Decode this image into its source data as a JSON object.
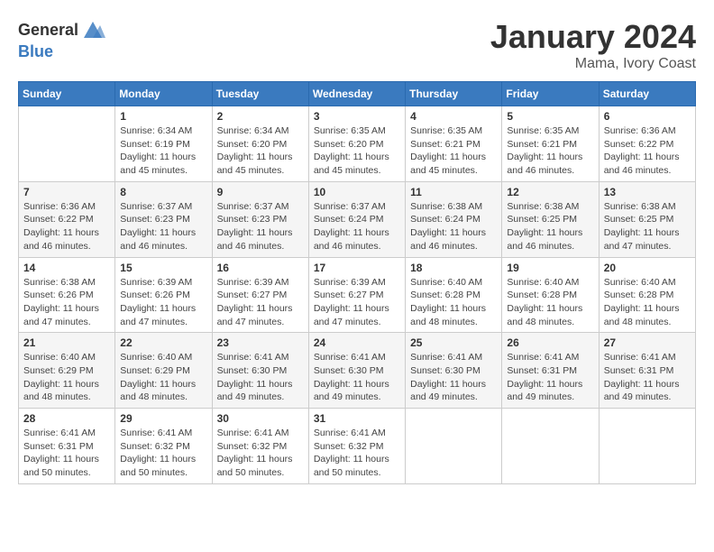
{
  "header": {
    "logo_general": "General",
    "logo_blue": "Blue",
    "month": "January 2024",
    "location": "Mama, Ivory Coast"
  },
  "weekdays": [
    "Sunday",
    "Monday",
    "Tuesday",
    "Wednesday",
    "Thursday",
    "Friday",
    "Saturday"
  ],
  "weeks": [
    [
      {
        "day": "",
        "sunrise": "",
        "sunset": "",
        "daylight": ""
      },
      {
        "day": "1",
        "sunrise": "Sunrise: 6:34 AM",
        "sunset": "Sunset: 6:19 PM",
        "daylight": "Daylight: 11 hours and 45 minutes."
      },
      {
        "day": "2",
        "sunrise": "Sunrise: 6:34 AM",
        "sunset": "Sunset: 6:20 PM",
        "daylight": "Daylight: 11 hours and 45 minutes."
      },
      {
        "day": "3",
        "sunrise": "Sunrise: 6:35 AM",
        "sunset": "Sunset: 6:20 PM",
        "daylight": "Daylight: 11 hours and 45 minutes."
      },
      {
        "day": "4",
        "sunrise": "Sunrise: 6:35 AM",
        "sunset": "Sunset: 6:21 PM",
        "daylight": "Daylight: 11 hours and 45 minutes."
      },
      {
        "day": "5",
        "sunrise": "Sunrise: 6:35 AM",
        "sunset": "Sunset: 6:21 PM",
        "daylight": "Daylight: 11 hours and 46 minutes."
      },
      {
        "day": "6",
        "sunrise": "Sunrise: 6:36 AM",
        "sunset": "Sunset: 6:22 PM",
        "daylight": "Daylight: 11 hours and 46 minutes."
      }
    ],
    [
      {
        "day": "7",
        "sunrise": "Sunrise: 6:36 AM",
        "sunset": "Sunset: 6:22 PM",
        "daylight": "Daylight: 11 hours and 46 minutes."
      },
      {
        "day": "8",
        "sunrise": "Sunrise: 6:37 AM",
        "sunset": "Sunset: 6:23 PM",
        "daylight": "Daylight: 11 hours and 46 minutes."
      },
      {
        "day": "9",
        "sunrise": "Sunrise: 6:37 AM",
        "sunset": "Sunset: 6:23 PM",
        "daylight": "Daylight: 11 hours and 46 minutes."
      },
      {
        "day": "10",
        "sunrise": "Sunrise: 6:37 AM",
        "sunset": "Sunset: 6:24 PM",
        "daylight": "Daylight: 11 hours and 46 minutes."
      },
      {
        "day": "11",
        "sunrise": "Sunrise: 6:38 AM",
        "sunset": "Sunset: 6:24 PM",
        "daylight": "Daylight: 11 hours and 46 minutes."
      },
      {
        "day": "12",
        "sunrise": "Sunrise: 6:38 AM",
        "sunset": "Sunset: 6:25 PM",
        "daylight": "Daylight: 11 hours and 46 minutes."
      },
      {
        "day": "13",
        "sunrise": "Sunrise: 6:38 AM",
        "sunset": "Sunset: 6:25 PM",
        "daylight": "Daylight: 11 hours and 47 minutes."
      }
    ],
    [
      {
        "day": "14",
        "sunrise": "Sunrise: 6:38 AM",
        "sunset": "Sunset: 6:26 PM",
        "daylight": "Daylight: 11 hours and 47 minutes."
      },
      {
        "day": "15",
        "sunrise": "Sunrise: 6:39 AM",
        "sunset": "Sunset: 6:26 PM",
        "daylight": "Daylight: 11 hours and 47 minutes."
      },
      {
        "day": "16",
        "sunrise": "Sunrise: 6:39 AM",
        "sunset": "Sunset: 6:27 PM",
        "daylight": "Daylight: 11 hours and 47 minutes."
      },
      {
        "day": "17",
        "sunrise": "Sunrise: 6:39 AM",
        "sunset": "Sunset: 6:27 PM",
        "daylight": "Daylight: 11 hours and 47 minutes."
      },
      {
        "day": "18",
        "sunrise": "Sunrise: 6:40 AM",
        "sunset": "Sunset: 6:28 PM",
        "daylight": "Daylight: 11 hours and 48 minutes."
      },
      {
        "day": "19",
        "sunrise": "Sunrise: 6:40 AM",
        "sunset": "Sunset: 6:28 PM",
        "daylight": "Daylight: 11 hours and 48 minutes."
      },
      {
        "day": "20",
        "sunrise": "Sunrise: 6:40 AM",
        "sunset": "Sunset: 6:28 PM",
        "daylight": "Daylight: 11 hours and 48 minutes."
      }
    ],
    [
      {
        "day": "21",
        "sunrise": "Sunrise: 6:40 AM",
        "sunset": "Sunset: 6:29 PM",
        "daylight": "Daylight: 11 hours and 48 minutes."
      },
      {
        "day": "22",
        "sunrise": "Sunrise: 6:40 AM",
        "sunset": "Sunset: 6:29 PM",
        "daylight": "Daylight: 11 hours and 48 minutes."
      },
      {
        "day": "23",
        "sunrise": "Sunrise: 6:41 AM",
        "sunset": "Sunset: 6:30 PM",
        "daylight": "Daylight: 11 hours and 49 minutes."
      },
      {
        "day": "24",
        "sunrise": "Sunrise: 6:41 AM",
        "sunset": "Sunset: 6:30 PM",
        "daylight": "Daylight: 11 hours and 49 minutes."
      },
      {
        "day": "25",
        "sunrise": "Sunrise: 6:41 AM",
        "sunset": "Sunset: 6:30 PM",
        "daylight": "Daylight: 11 hours and 49 minutes."
      },
      {
        "day": "26",
        "sunrise": "Sunrise: 6:41 AM",
        "sunset": "Sunset: 6:31 PM",
        "daylight": "Daylight: 11 hours and 49 minutes."
      },
      {
        "day": "27",
        "sunrise": "Sunrise: 6:41 AM",
        "sunset": "Sunset: 6:31 PM",
        "daylight": "Daylight: 11 hours and 49 minutes."
      }
    ],
    [
      {
        "day": "28",
        "sunrise": "Sunrise: 6:41 AM",
        "sunset": "Sunset: 6:31 PM",
        "daylight": "Daylight: 11 hours and 50 minutes."
      },
      {
        "day": "29",
        "sunrise": "Sunrise: 6:41 AM",
        "sunset": "Sunset: 6:32 PM",
        "daylight": "Daylight: 11 hours and 50 minutes."
      },
      {
        "day": "30",
        "sunrise": "Sunrise: 6:41 AM",
        "sunset": "Sunset: 6:32 PM",
        "daylight": "Daylight: 11 hours and 50 minutes."
      },
      {
        "day": "31",
        "sunrise": "Sunrise: 6:41 AM",
        "sunset": "Sunset: 6:32 PM",
        "daylight": "Daylight: 11 hours and 50 minutes."
      },
      {
        "day": "",
        "sunrise": "",
        "sunset": "",
        "daylight": ""
      },
      {
        "day": "",
        "sunrise": "",
        "sunset": "",
        "daylight": ""
      },
      {
        "day": "",
        "sunrise": "",
        "sunset": "",
        "daylight": ""
      }
    ]
  ]
}
